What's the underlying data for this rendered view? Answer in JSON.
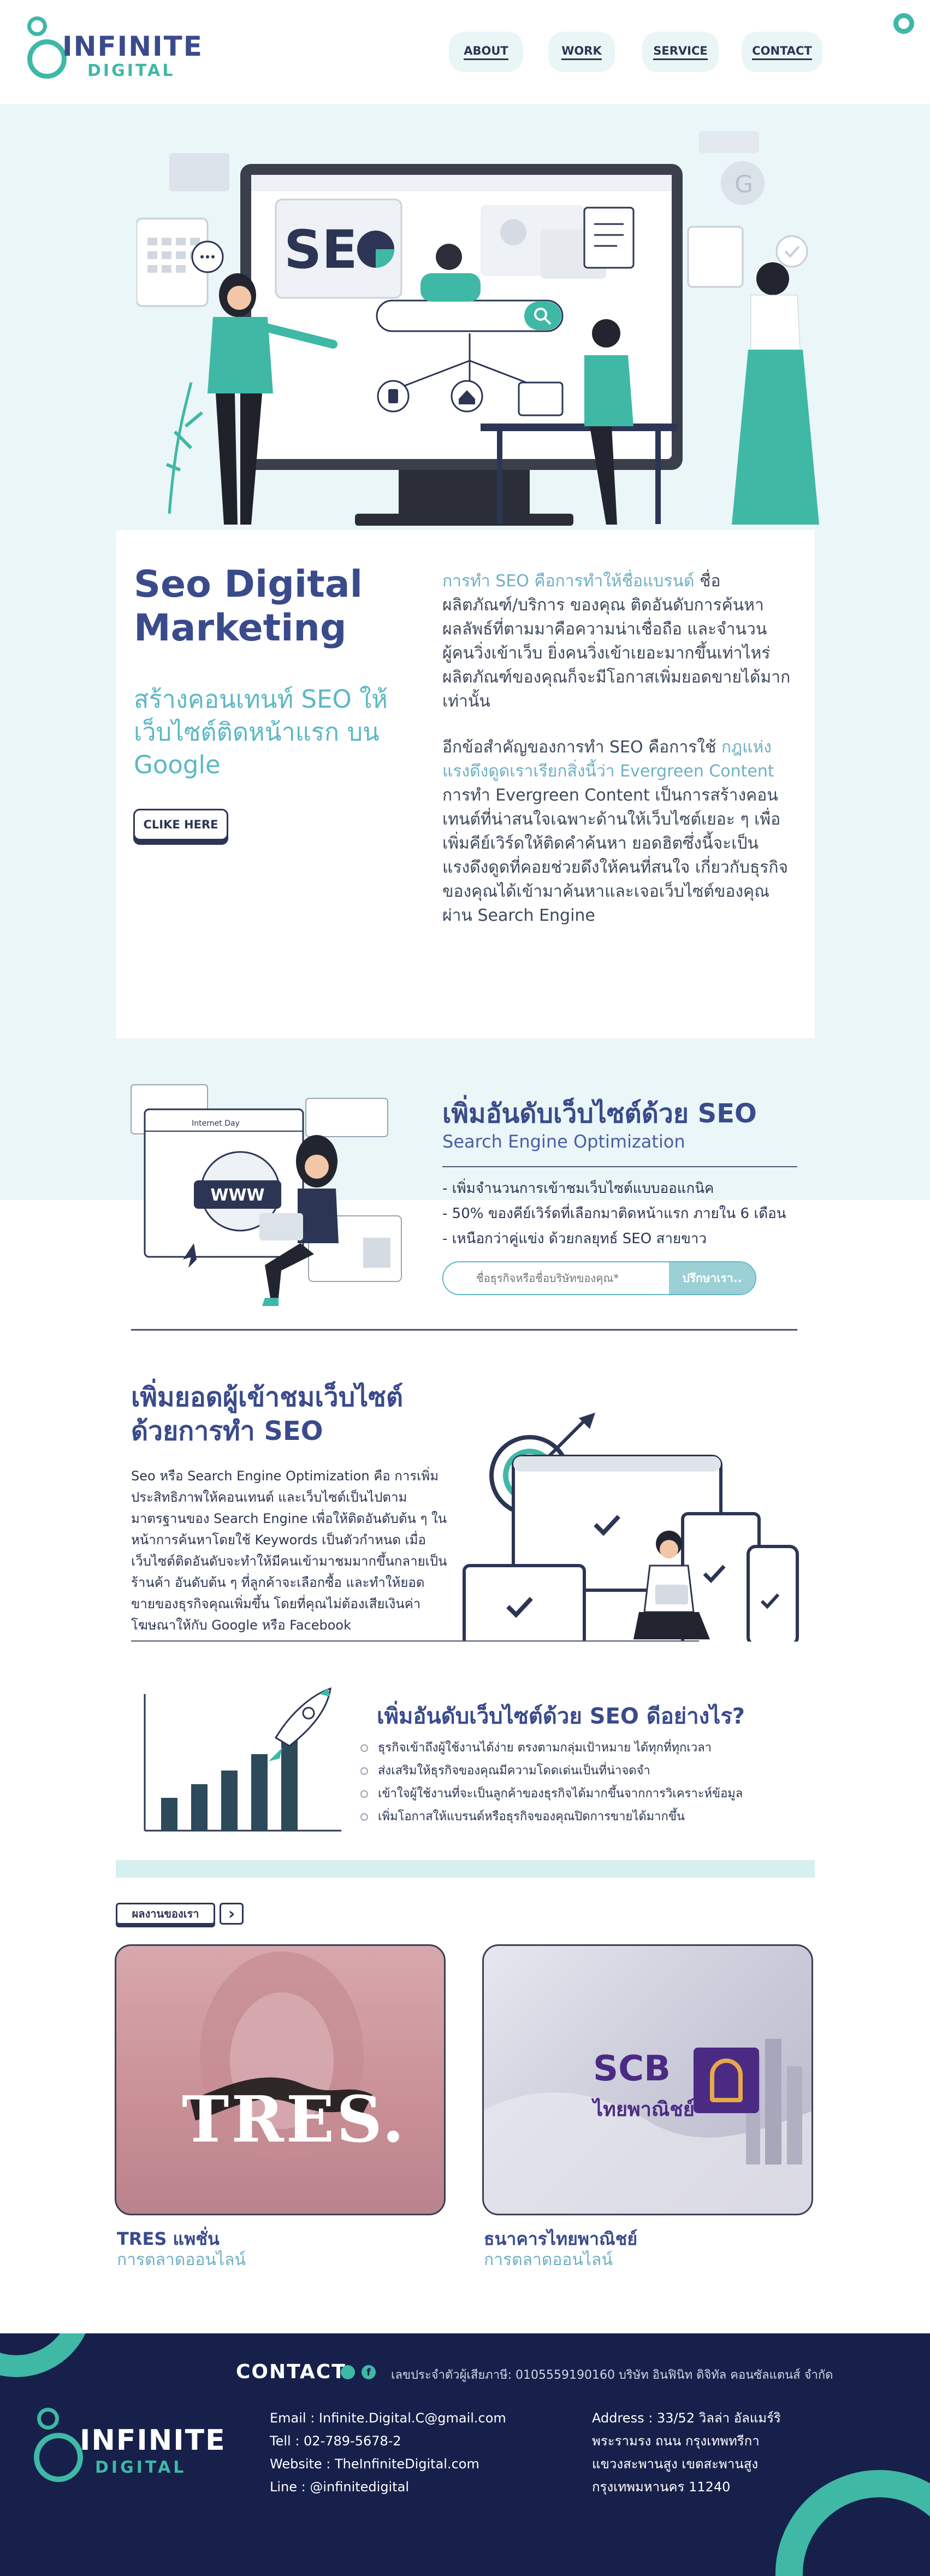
{
  "header": {
    "logo_main": "INFINITE",
    "logo_sub": "DIGITAL",
    "nav": [
      "ABOUT",
      "WORK",
      "SERVICE",
      "CONTACT"
    ]
  },
  "hero": {
    "illustration_label": "SEO",
    "title": "Seo Digital Marketing",
    "subtitle": "สร้างคอนเทนท์ SEO ให้เว็บไซต์ติดหน้าแรก บน Google",
    "cta": "CLIKE HERE",
    "para1_accent": "การทำ SEO คือการทำให้ชื่อแบรนด์",
    "para1": "ชื่อผลิตภัณฑ์/บริการ ของคุณ ติดอันดับการค้นหา ผลลัพธ์ที่ตามมาคือความน่าเชื่อถือ และจำนวนผู้คนวิ่งเข้าเว็บ ยิ่งคนวิ่งเข้าเยอะมากขึ้นเท่าไหร่ ผลิตภัณฑ์ของคุณก็จะมีโอกาสเพิ่มยอดขายได้มากเท่านั้น",
    "para2_start": "อีกข้อสำคัญของการทำ SEO คือการใช้",
    "para2_accent": "กฎแห่งแรงดึงดูดเราเรียกสิ่งนี้ว่า Evergreen Content",
    "para2_end": "การทำ Evergreen Content เป็นการสร้างคอนเทนต์ที่น่าสนใจเฉพาะด้านให้เว็บไซต์เยอะ ๆ เพื่อเพิ่มคีย์เวิร์ดให้ติดคำค้นหา ยอดฮิตซึ่งนี้จะเป็นแรงดึงดูดที่คอยช่วยดึงให้คนที่สนใจ เกี่ยวกับธุรกิจของคุณได้เข้ามาค้นหาและเจอเว็บไซต์ของคุณผ่าน Search Engine"
  },
  "rank_section": {
    "browser_title": "Internet Day",
    "www": "WWW",
    "title": "เพิ่มอันดับเว็บไซต์ด้วย SEO",
    "subtitle": "Search Engine Optimization",
    "bullets": [
      "- เพิ่มจำนวนการเข้าชมเว็บไซต์แบบออแกนิค",
      "- 50% ของคีย์เวิร์ดที่เลือกมาติดหน้าแรก ภายใน 6 เดือน",
      "- เหนือกว่าคู่แข่ง ด้วยกลยุทธ์ SEO สายขาว"
    ],
    "search_placeholder": "ชื่อธุรกิจหรือชื่อบริษัทของคุณ*",
    "search_button": "ปรึกษาเรา.."
  },
  "traffic_section": {
    "title": "เพิ่มยอดผู้เข้าชมเว็บไซต์ ด้วยการทำ SEO",
    "body": "Seo หรือ Search Engine Optimization คือ การเพิ่มประสิทธิภาพให้คอนเทนต์ และเว็บไซต์เป็นไปตามมาตรฐานของ Search Engine เพื่อให้ติดอันดับต้น ๆ ในหน้าการค้นหาโดยใช้ Keywords เป็นตัวกำหนด เมื่อเว็บไซต์ติดอันดับจะทำให้มีคนเข้ามาชมมากขึ้นกลายเป็นร้านค้า อันดับต้น ๆ ที่ลูกค้าจะเลือกซื้อ และทำให้ยอดขายของธุรกิจคุณเพิ่มขึ้น โดยที่คุณไม่ต้องเสียเงินค่าโฆษณาให้กับ Google หรือ Facebook"
  },
  "how_section": {
    "title": "เพิ่มอันดับเว็บไซต์ด้วย SEO ดีอย่างไร?",
    "items": [
      "ธุรกิจเข้าถึงผู้ใช้งานได้ง่าย ตรงตามกลุ่มเป้าหมาย ได้ทุกที่ทุกเวลา",
      "ส่งเสริมให้ธุรกิจของคุณมีความโดดเด่นเป็นที่น่าจดจำ",
      "เข้าใจผู้ใช้งานที่จะเป็นลูกค้าของธุรกิจได้มากขึ้นจากการวิเคราะห์ข้อมูล",
      "เพิ่มโอกาสให้แบรนด์หรือธุรกิจของคุณปิดการขายได้มากขึ้น"
    ]
  },
  "portfolio": {
    "label": "ผลงานของเรา",
    "arrow": "›",
    "items": [
      {
        "logo": "TRES.",
        "title": "TRES แพชั่น",
        "sub": "การตลาดออนไลน์"
      },
      {
        "logo": "SCB",
        "logo_sub": "ไทยพาณิชย์",
        "title": "ธนาคารไทยพาณิชย์",
        "sub": "การตลาดออนไลน์"
      }
    ]
  },
  "footer": {
    "contact_label": "CONTACT",
    "registration": "เลขประจำตัวผู้เสียภาษี: 0105559190160 บริษัท อินฟินิท ดิจิทัล คอนซัลแตนส์ จำกัด",
    "logo_main": "INFINITE",
    "logo_sub": "DIGITAL",
    "email": "Email : Infinite.Digital.C@gmail.com",
    "tel": "Tell : 02-789-5678-2",
    "website": "Website : TheInfiniteDigital.com",
    "line": "Line : @infinitedigital",
    "address": [
      "Address : 33/52 วิลล่า อัลแมร์ริ",
      "พระรามรง ถนน กรุงเทพทรีกา",
      "แขวงสะพานสูง เขตสะพานสูง",
      "กรุงเทพมหานคร 11240"
    ]
  },
  "colors": {
    "navy": "#3a4b8c",
    "teal": "#3fb8a6",
    "light_teal": "#eaf6f7",
    "footer_bg": "#16204a",
    "accent_blue": "#6fb0c3"
  }
}
